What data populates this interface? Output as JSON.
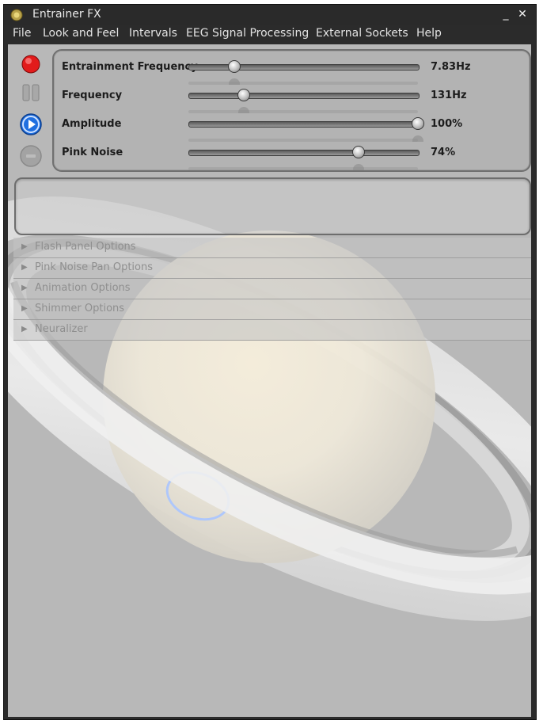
{
  "window": {
    "title": "Entrainer FX"
  },
  "window_controls": {
    "minimize": "_",
    "close": "✕"
  },
  "menu": {
    "items": [
      "File",
      "Look and Feel",
      "Intervals",
      "EEG Signal Processing",
      "External Sockets",
      "Help"
    ]
  },
  "sidebar": {
    "buttons": [
      {
        "name": "record-icon",
        "color": "#e21b1b"
      },
      {
        "name": "pause-icon",
        "color": "#9a9a9a"
      },
      {
        "name": "play-icon",
        "color": "#1f6fe0"
      },
      {
        "name": "stop-icon",
        "color": "#9a9a9a"
      }
    ]
  },
  "controls": [
    {
      "label": "Entrainment Frequency",
      "value": "7.83Hz",
      "level": 0.2
    },
    {
      "label": "Frequency",
      "value": "131Hz",
      "level": 0.24
    },
    {
      "label": "Amplitude",
      "value": "100%",
      "level": 1.0
    },
    {
      "label": "Pink Noise",
      "value": "74%",
      "level": 0.74
    }
  ],
  "sections": [
    "Flash Panel Options",
    "Pink Noise Pan Options",
    "Animation Options",
    "Shimmer Options",
    "Neuralizer"
  ]
}
